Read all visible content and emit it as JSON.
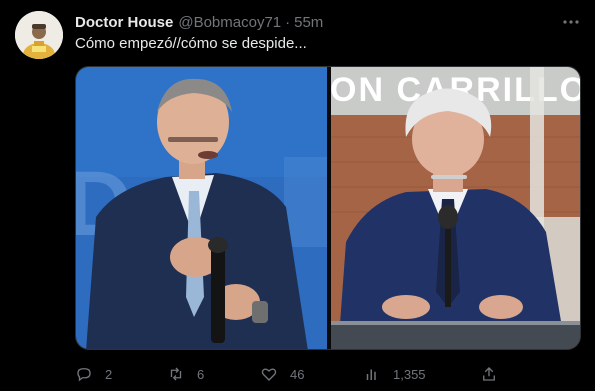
{
  "tweet": {
    "author_name": "Doctor House",
    "handle": "@Bobmacoy71",
    "separator": "·",
    "time": "55m",
    "text": "Cómo empezó//cómo se despide...",
    "left_photo_background_text": "D",
    "right_photo_sign_text": "ON CARRILLO"
  },
  "actions": {
    "reply_count": "2",
    "retweet_count": "6",
    "like_count": "46",
    "views_count": "1,355"
  },
  "icons": {
    "more": "more-horizontal-icon",
    "reply": "reply-icon",
    "retweet": "retweet-icon",
    "like": "heart-icon",
    "views": "views-icon",
    "share": "share-icon"
  },
  "colors": {
    "background": "#000000",
    "text_primary": "#e7e9ea",
    "text_secondary": "#71767b",
    "left_photo_blue": "#2f6fc2"
  }
}
